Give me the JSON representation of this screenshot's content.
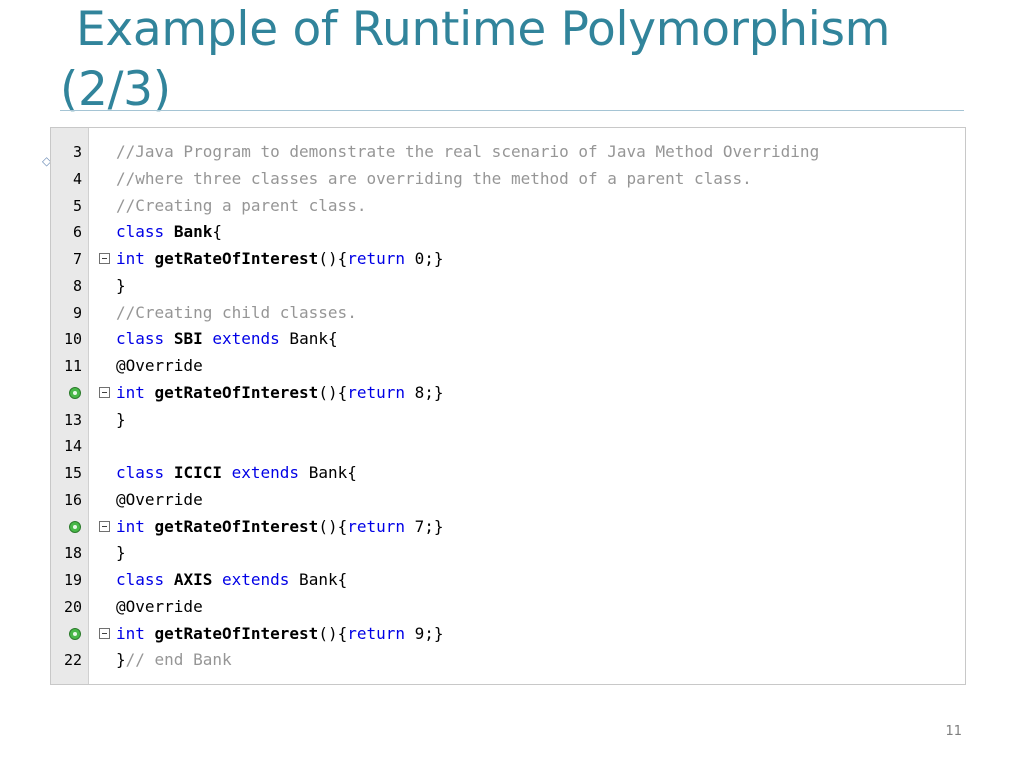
{
  "slide": {
    "title_line1": "Example of Runtime Polymorphism",
    "title_line2": "(2/3)",
    "page_number": "11",
    "accent_color": "#31849b"
  },
  "editor": {
    "lines": [
      {
        "num": "3",
        "text": "//Java Program to demonstrate the real scenario of Java Method Overriding",
        "kind": "comment"
      },
      {
        "num": "4",
        "text": "//where three classes are overriding the method of a parent class.",
        "kind": "comment"
      },
      {
        "num": "5",
        "text": "//Creating a parent class.",
        "kind": "comment"
      },
      {
        "num": "6",
        "parts": [
          "class",
          " ",
          "Bank",
          "{"
        ]
      },
      {
        "num": "7",
        "fold": true,
        "parts": [
          "int",
          " ",
          "getRateOfInterest",
          "(){",
          "return",
          " 0;}"
        ]
      },
      {
        "num": "8",
        "parts": [
          "}"
        ]
      },
      {
        "num": "9",
        "text": "//Creating child classes.",
        "kind": "comment"
      },
      {
        "num": "10",
        "parts": [
          "class",
          " ",
          "SBI",
          " ",
          "extends",
          " Bank{"
        ]
      },
      {
        "num": "11",
        "parts": [
          "@Override"
        ]
      },
      {
        "num": "",
        "marker": true,
        "fold": true,
        "parts": [
          "int",
          " ",
          "getRateOfInterest",
          "(){",
          "return",
          " 8;}"
        ]
      },
      {
        "num": "13",
        "parts": [
          "}"
        ]
      },
      {
        "num": "14",
        "parts": [
          ""
        ]
      },
      {
        "num": "15",
        "parts": [
          "class",
          " ",
          "ICICI",
          " ",
          "extends",
          " Bank{"
        ]
      },
      {
        "num": "16",
        "parts": [
          "@Override"
        ]
      },
      {
        "num": "",
        "marker": true,
        "fold": true,
        "parts": [
          "int",
          " ",
          "getRateOfInterest",
          "(){",
          "return",
          " 7;}"
        ]
      },
      {
        "num": "18",
        "parts": [
          "}"
        ]
      },
      {
        "num": "19",
        "parts": [
          "class",
          " ",
          "AXIS",
          " ",
          "extends",
          " Bank{"
        ]
      },
      {
        "num": "20",
        "parts": [
          "@Override"
        ]
      },
      {
        "num": "",
        "marker": true,
        "fold": true,
        "parts": [
          "int",
          " ",
          "getRateOfInterest",
          "(){",
          "return",
          " 9;}"
        ]
      },
      {
        "num": "22",
        "parts": [
          "}",
          "// end Bank"
        ]
      }
    ]
  }
}
